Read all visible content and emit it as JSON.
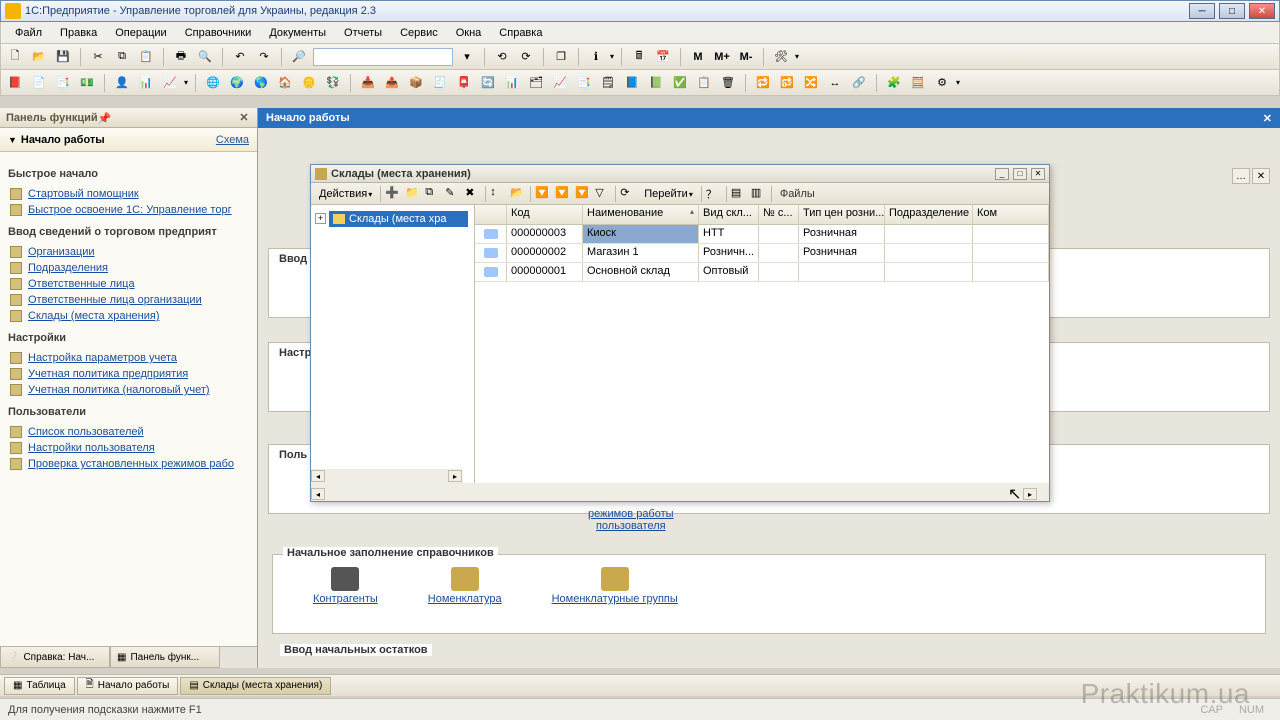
{
  "window": {
    "title": "1С:Предприятие - Управление торговлей для Украины, редакция 2.3"
  },
  "menu": [
    "Файл",
    "Правка",
    "Операции",
    "Справочники",
    "Документы",
    "Отчеты",
    "Сервис",
    "Окна",
    "Справка"
  ],
  "leftpanel": {
    "title": "Панель функций",
    "start": "Начало работы",
    "schema": "Схема",
    "sections": [
      {
        "title": "Быстрое начало",
        "links": [
          "Стартовый помощник",
          "Быстрое освоение 1С: Управление торг"
        ]
      },
      {
        "title": "Ввод сведений о торговом предприят",
        "links": [
          "Организации",
          "Подразделения",
          "Ответственные лица",
          "Ответственные лица организации",
          "Склады (места хранения)"
        ]
      },
      {
        "title": "Настройки",
        "links": [
          "Настройка параметров учета",
          "Учетная политика предприятия",
          "Учетная политика (налоговый учет)"
        ]
      },
      {
        "title": "Пользователи",
        "links": [
          "Список пользователей",
          "Настройки пользователя",
          "Проверка установленных режимов рабо"
        ]
      }
    ],
    "tabs": [
      "Справка: Нач...",
      "Панель функ..."
    ]
  },
  "main": {
    "header": "Начало работы",
    "subgroups": [
      "Ввод",
      "Настр",
      "Поль"
    ],
    "hint_lines": [
      "режимов работы",
      "пользователя"
    ],
    "ref_group_title": "Начальное заполнение справочников",
    "ref_items": [
      "Контрагенты",
      "Номенклатура",
      "Номенклатурные группы"
    ],
    "last_group": "Ввод начальных остатков"
  },
  "dialog": {
    "title": "Склады (места хранения)",
    "actions": "Действия",
    "goto": "Перейти",
    "files": "Файлы",
    "tree_root": "Склады (места хра",
    "columns": [
      "",
      "Код",
      "Наименование",
      "Вид скл...",
      "№ с...",
      "Тип цен розни...",
      "Подразделение",
      "Ком"
    ],
    "rows": [
      {
        "code": "000000003",
        "name": "Киоск",
        "kind": "НТТ",
        "num": "",
        "ptype": "Розничная",
        "dept": "",
        "com": ""
      },
      {
        "code": "000000002",
        "name": "Магазин 1",
        "kind": "Розничн...",
        "num": "",
        "ptype": "Розничная",
        "dept": "",
        "com": ""
      },
      {
        "code": "000000001",
        "name": "Основной склад",
        "kind": "Оптовый",
        "num": "",
        "ptype": "",
        "dept": "",
        "com": ""
      }
    ]
  },
  "taskbar": [
    "Таблица",
    "Начало работы",
    "Склады (места хранения)"
  ],
  "status": "Для получения подсказки нажмите F1",
  "status_right": [
    "CAP",
    "NUM"
  ],
  "watermark": "Praktikum.ua"
}
